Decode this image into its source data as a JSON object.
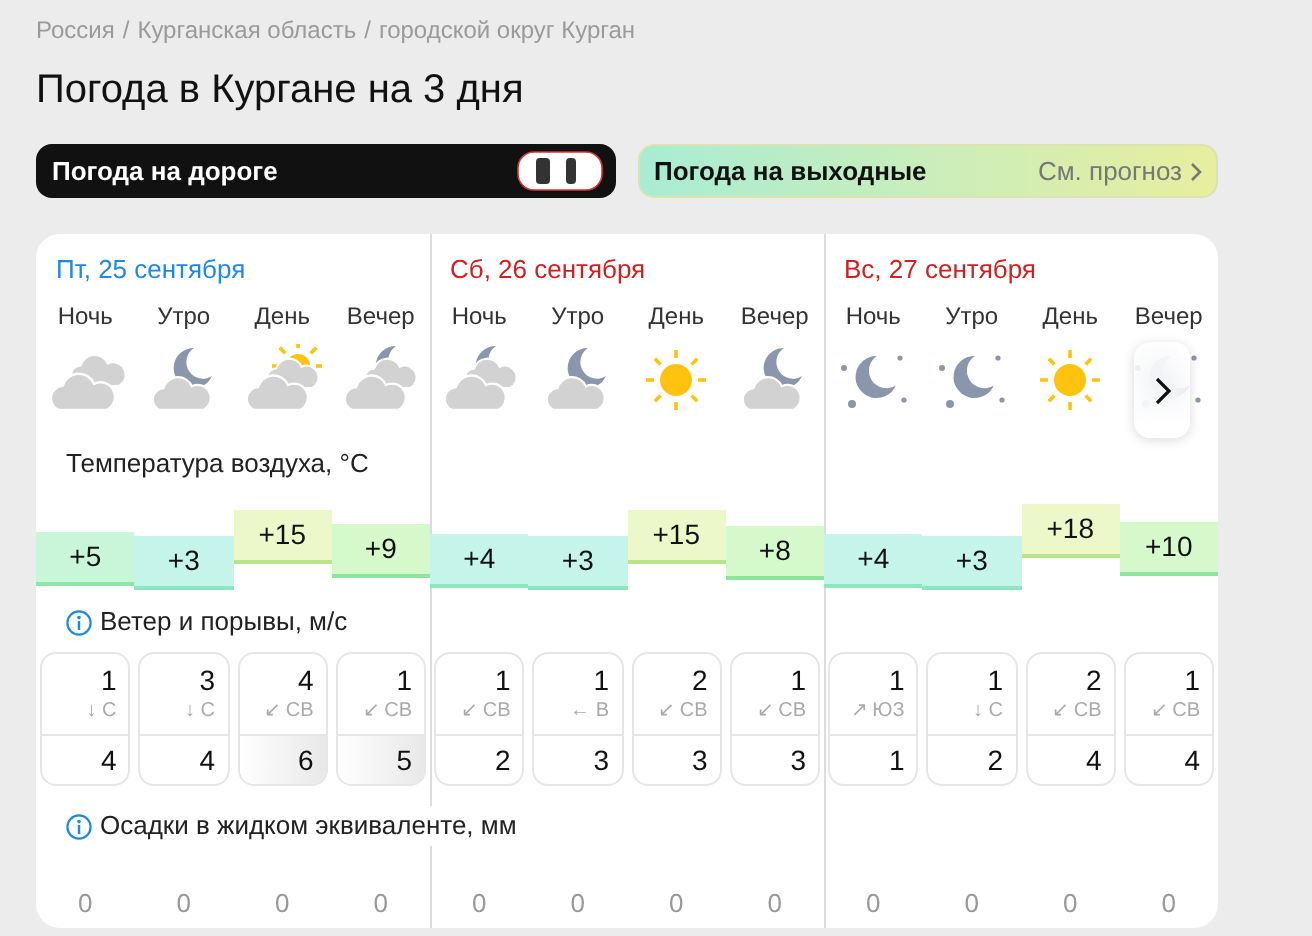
{
  "breadcrumbs": {
    "separator": "/",
    "items": [
      "Россия",
      "Курганская область",
      "городской округ Курган"
    ]
  },
  "title": "Погода в Кургане на 3 дня",
  "road_button": {
    "label": "Погода на дороге"
  },
  "weekend_banner": {
    "label": "Погода на выходные",
    "link": "См. прогноз"
  },
  "sections": {
    "temperature": "Температура воздуха, °C",
    "wind": "Ветер и порывы, м/с",
    "precipitation": "Осадки в жидком эквиваленте, мм"
  },
  "days": [
    {
      "date": "Пт, 25 сентября",
      "weekend": false,
      "periods": [
        {
          "label": "Ночь",
          "kind": "cloudy",
          "temperature": "+5",
          "wind": {
            "speed": "1",
            "direction": "↓ С",
            "gust": "4",
            "strong_gust": false
          },
          "precipitation": "0"
        },
        {
          "label": "Утро",
          "kind": "partly_cloudy_night",
          "temperature": "+3",
          "wind": {
            "speed": "3",
            "direction": "↓ С",
            "gust": "4",
            "strong_gust": false
          },
          "precipitation": "0"
        },
        {
          "label": "День",
          "kind": "cloudy_day",
          "temperature": "+15",
          "wind": {
            "speed": "4",
            "direction": "↙ СВ",
            "gust": "6",
            "strong_gust": true
          },
          "precipitation": "0"
        },
        {
          "label": "Вечер",
          "kind": "cloudy_night",
          "temperature": "+9",
          "wind": {
            "speed": "1",
            "direction": "↙ СВ",
            "gust": "5",
            "strong_gust": true
          },
          "precipitation": "0"
        }
      ]
    },
    {
      "date": "Сб, 26 сентября",
      "weekend": true,
      "periods": [
        {
          "label": "Ночь",
          "kind": "cloudy_night",
          "temperature": "+4",
          "wind": {
            "speed": "1",
            "direction": "↙ СВ",
            "gust": "2",
            "strong_gust": false
          },
          "precipitation": "0"
        },
        {
          "label": "Утро",
          "kind": "partly_cloudy_night",
          "temperature": "+3",
          "wind": {
            "speed": "1",
            "direction": "← В",
            "gust": "3",
            "strong_gust": false
          },
          "precipitation": "0"
        },
        {
          "label": "День",
          "kind": "clear_day",
          "temperature": "+15",
          "wind": {
            "speed": "2",
            "direction": "↙ СВ",
            "gust": "3",
            "strong_gust": false
          },
          "precipitation": "0"
        },
        {
          "label": "Вечер",
          "kind": "partly_cloudy_night",
          "temperature": "+8",
          "wind": {
            "speed": "1",
            "direction": "↙ СВ",
            "gust": "3",
            "strong_gust": false
          },
          "precipitation": "0"
        }
      ]
    },
    {
      "date": "Вс, 27 сентября",
      "weekend": true,
      "periods": [
        {
          "label": "Ночь",
          "kind": "clear_night",
          "temperature": "+4",
          "wind": {
            "speed": "1",
            "direction": "↗ ЮЗ",
            "gust": "1",
            "strong_gust": false
          },
          "precipitation": "0"
        },
        {
          "label": "Утро",
          "kind": "clear_night",
          "temperature": "+3",
          "wind": {
            "speed": "1",
            "direction": "↓ С",
            "gust": "2",
            "strong_gust": false
          },
          "precipitation": "0"
        },
        {
          "label": "День",
          "kind": "clear_day",
          "temperature": "+18",
          "wind": {
            "speed": "2",
            "direction": "↙ СВ",
            "gust": "4",
            "strong_gust": false
          },
          "precipitation": "0"
        },
        {
          "label": "Вечер",
          "kind": "clear_night",
          "temperature": "+10",
          "wind": {
            "speed": "1",
            "direction": "↙ СВ",
            "gust": "4",
            "strong_gust": false
          },
          "precipitation": "0"
        }
      ]
    }
  ]
}
